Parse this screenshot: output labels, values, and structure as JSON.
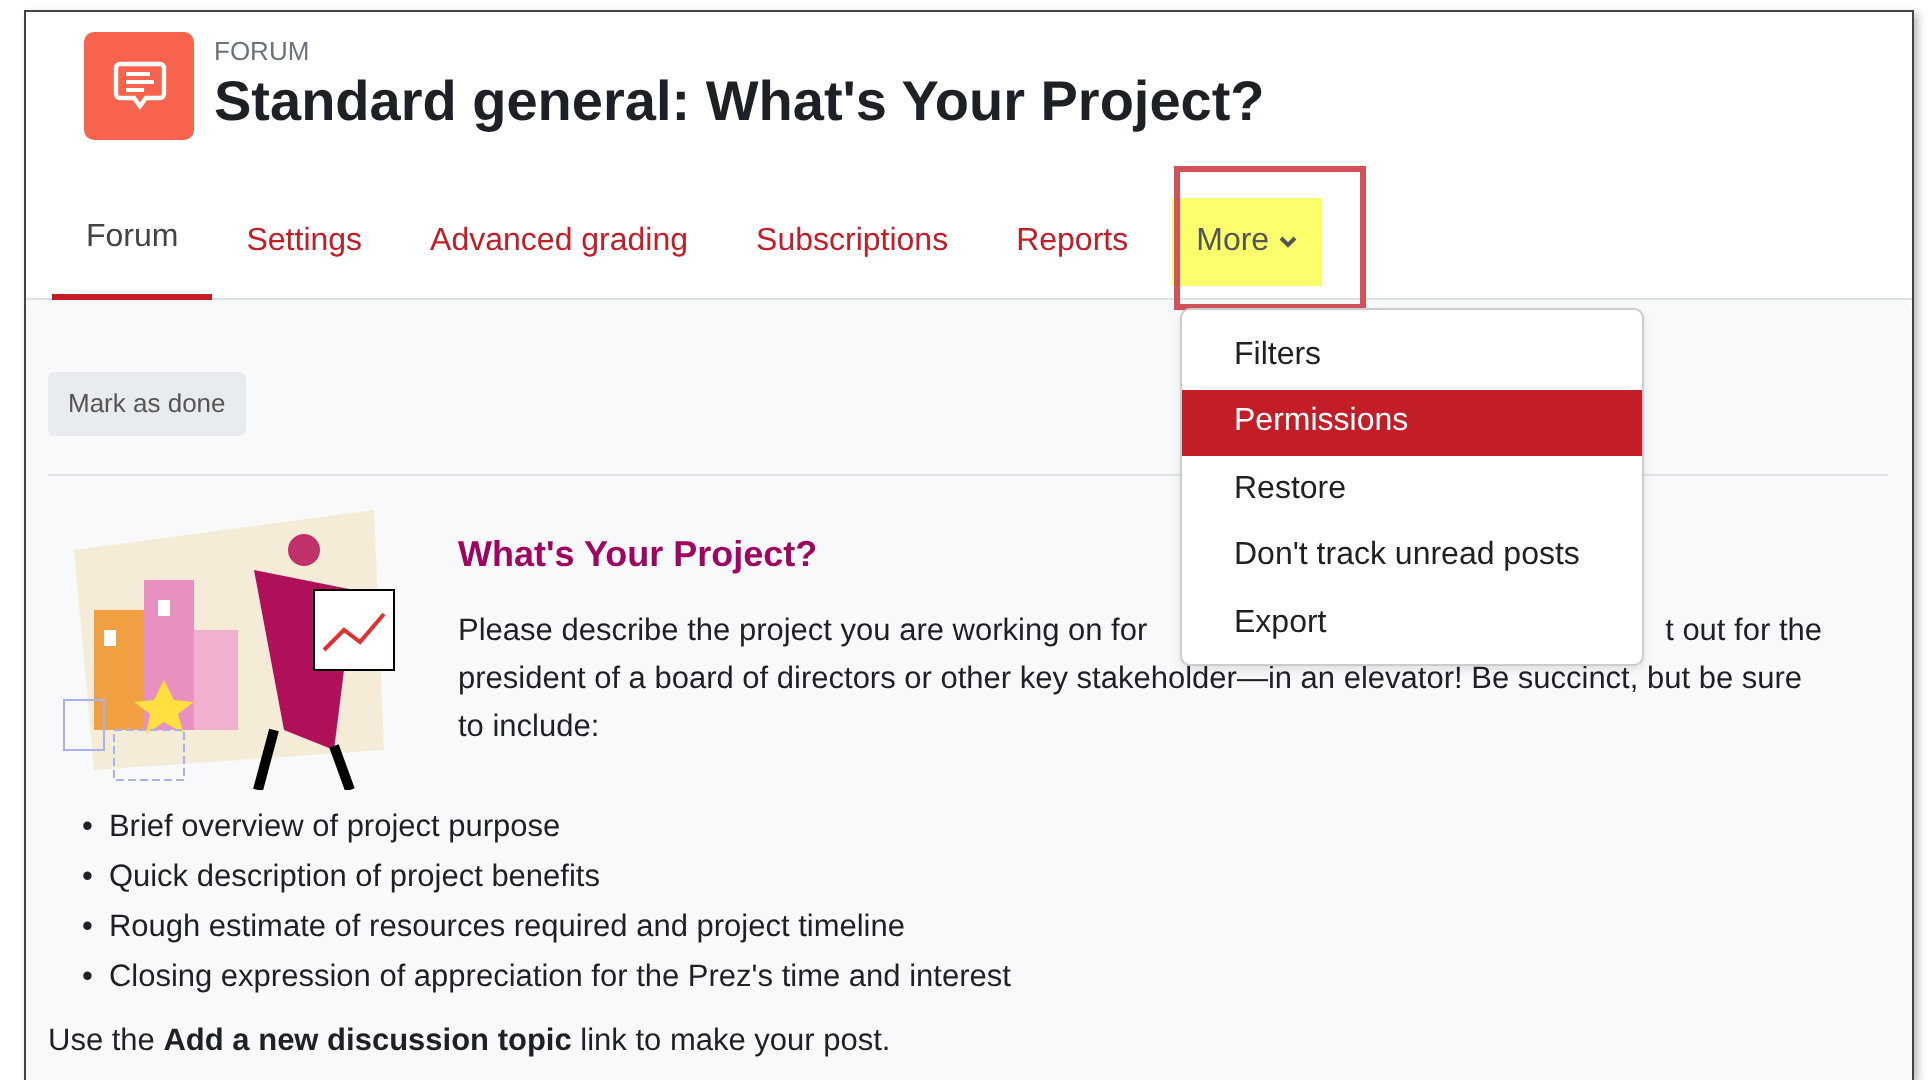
{
  "header": {
    "module_type": "FORUM",
    "title": "Standard general: What's Your Project?"
  },
  "tabs": [
    {
      "label": "Forum",
      "selected": true,
      "kind": "link",
      "highlighted": false
    },
    {
      "label": "Settings",
      "selected": false,
      "kind": "link",
      "highlighted": false
    },
    {
      "label": "Advanced grading",
      "selected": false,
      "kind": "link",
      "highlighted": false
    },
    {
      "label": "Subscriptions",
      "selected": false,
      "kind": "link",
      "highlighted": false
    },
    {
      "label": "Reports",
      "selected": false,
      "kind": "link",
      "highlighted": false
    },
    {
      "label": "More",
      "selected": false,
      "kind": "dropdown",
      "highlighted": true
    }
  ],
  "menu": {
    "items": [
      {
        "label": "Filters",
        "selected": false
      },
      {
        "label": "Permissions",
        "selected": true
      },
      {
        "label": "Restore",
        "selected": false
      },
      {
        "label": "Don't track unread posts",
        "selected": false
      },
      {
        "label": "Export",
        "selected": false
      }
    ]
  },
  "mark_done_button": "Mark as done",
  "intro": {
    "heading": "What's Your Project?",
    "paragraph": {
      "before_menu": "Please describe the project you are working on for",
      "after_menu": "t out for the",
      "lines": [
        "president of a board of directors or other key stakeholder—in an elevator! Be succinct, but be sure",
        "to include:"
      ]
    },
    "bullets": [
      {
        "marker": "•",
        "text": "Brief overview of project purpose"
      },
      {
        "marker": "•",
        "text": "Quick description of project benefits"
      },
      {
        "marker": "•",
        "text": "Rough estimate of resources required and project timeline"
      },
      {
        "marker": "•",
        "text": "Closing expression of appreciation for the Prez's time and interest"
      }
    ],
    "footer": "Use the **Add a new discussion topic** link to make your post."
  }
}
